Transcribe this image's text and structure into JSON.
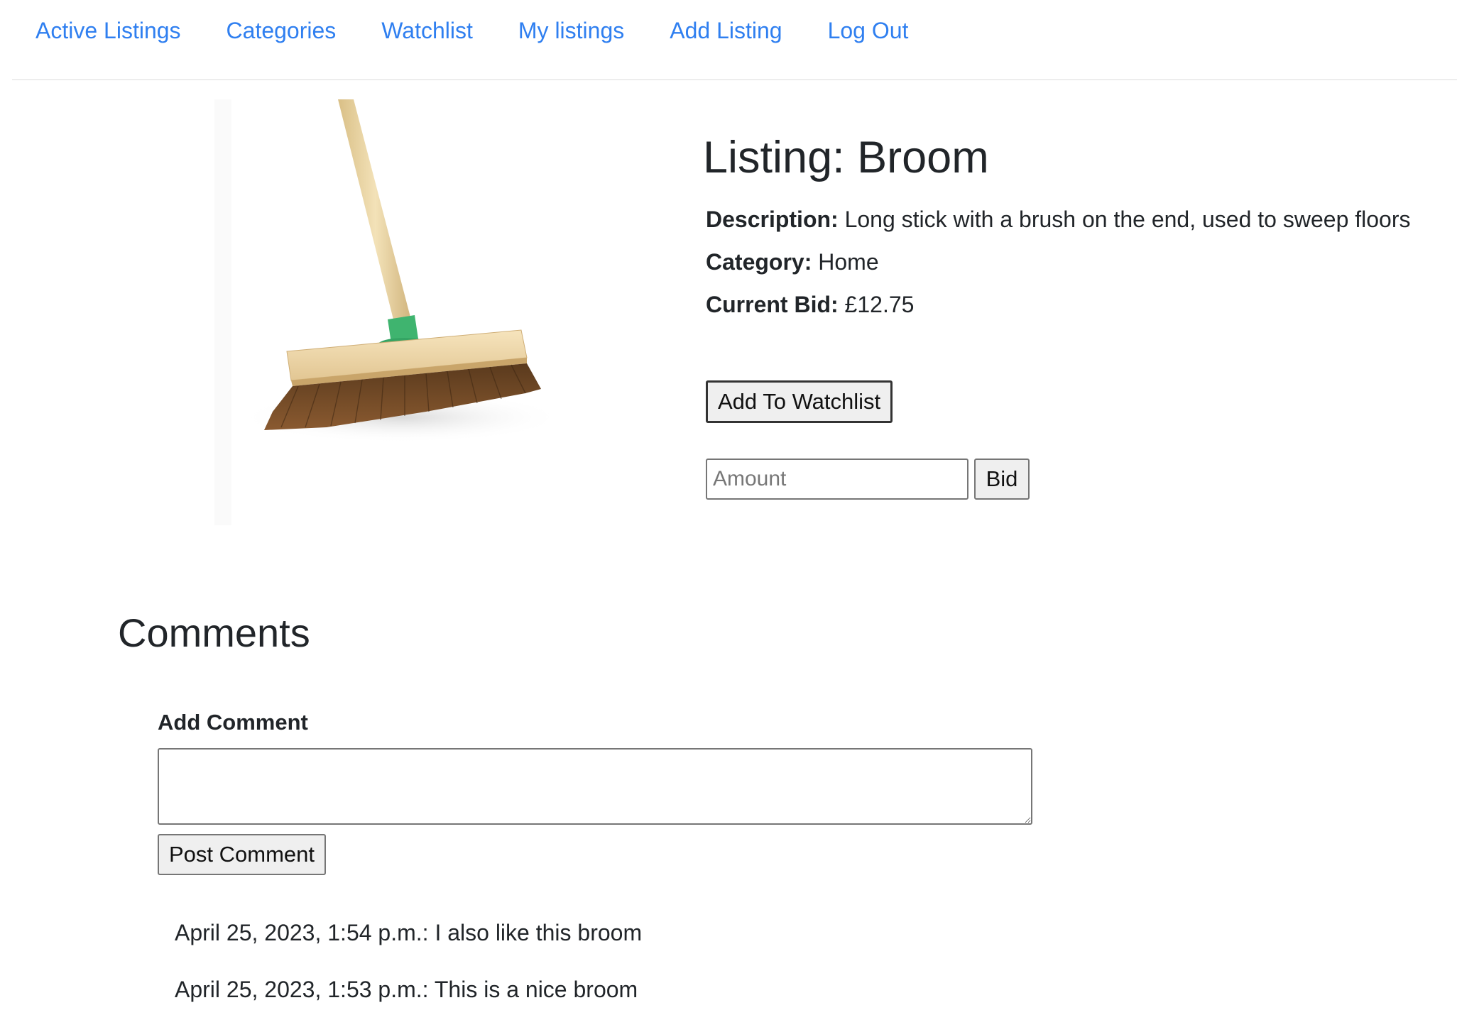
{
  "nav": {
    "items": [
      "Active Listings",
      "Categories",
      "Watchlist",
      "My listings",
      "Add Listing",
      "Log Out"
    ]
  },
  "listing": {
    "title": "Listing: Broom",
    "image_icon": "broom-image",
    "description_label": "Description:",
    "description": "Long stick with a brush on the end, used to sweep floors",
    "category_label": "Category:",
    "category": "Home",
    "current_bid_label": "Current Bid:",
    "current_bid": "£12.75"
  },
  "actions": {
    "watchlist_button": "Add To Watchlist",
    "amount_placeholder": "Amount",
    "bid_button": "Bid"
  },
  "comments": {
    "heading": "Comments",
    "add_label": "Add Comment",
    "post_button": "Post Comment",
    "entries": [
      "April 25, 2023, 1:54 p.m.: I also like this broom",
      "April 25, 2023, 1:53 p.m.: This is a nice broom"
    ]
  },
  "colors": {
    "link": "#2f7ff0",
    "text": "#212529",
    "broom_handle": "#ecd7a6",
    "broom_block": "#f2dcae",
    "broom_collar": "#3cb371",
    "bristles": "#6b4423"
  }
}
